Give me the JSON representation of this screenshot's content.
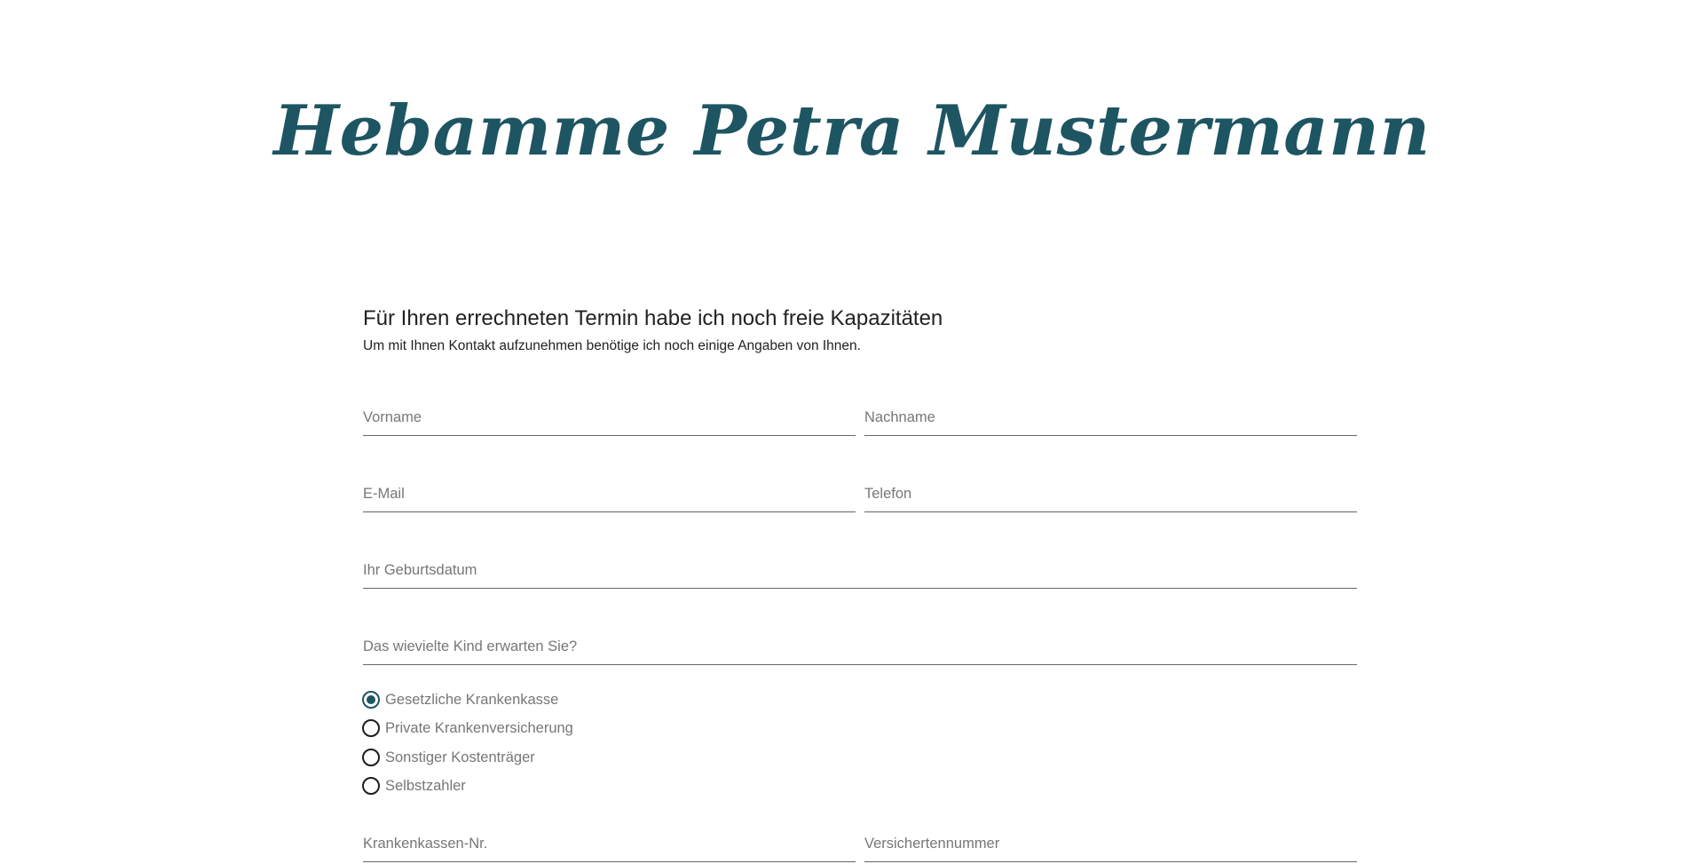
{
  "header": {
    "title": "Hebamme Petra Mustermann"
  },
  "intro": {
    "heading": "Für Ihren errechneten Termin habe ich noch freie Kapazitäten",
    "text": "Um mit Ihnen Kontakt aufzunehmen benötige ich noch einige Angaben von Ihnen."
  },
  "form": {
    "fields": {
      "vorname": {
        "placeholder": "Vorname",
        "value": ""
      },
      "nachname": {
        "placeholder": "Nachname",
        "value": ""
      },
      "email": {
        "placeholder": "E-Mail",
        "value": ""
      },
      "telefon": {
        "placeholder": "Telefon",
        "value": ""
      },
      "geburtsdatum": {
        "placeholder": "Ihr Geburtsdatum",
        "value": ""
      },
      "kind": {
        "placeholder": "Das wievielte Kind erwarten Sie?",
        "value": ""
      },
      "krankenkassen_nr": {
        "placeholder": "Krankenkassen-Nr.",
        "value": ""
      },
      "versichertennummer": {
        "placeholder": "Versichertennummer",
        "value": ""
      }
    },
    "insurance": {
      "selected": "Gesetzliche Krankenkasse",
      "options": [
        {
          "label": "Gesetzliche Krankenkasse",
          "checked": true
        },
        {
          "label": "Private Krankenversicherung",
          "checked": false
        },
        {
          "label": "Sonstiger Kostenträger",
          "checked": false
        },
        {
          "label": "Selbstzahler",
          "checked": false
        }
      ]
    }
  },
  "colors": {
    "brand": "#1e5562",
    "text": "#222222",
    "placeholder": "#777777",
    "underline": "#666666"
  }
}
